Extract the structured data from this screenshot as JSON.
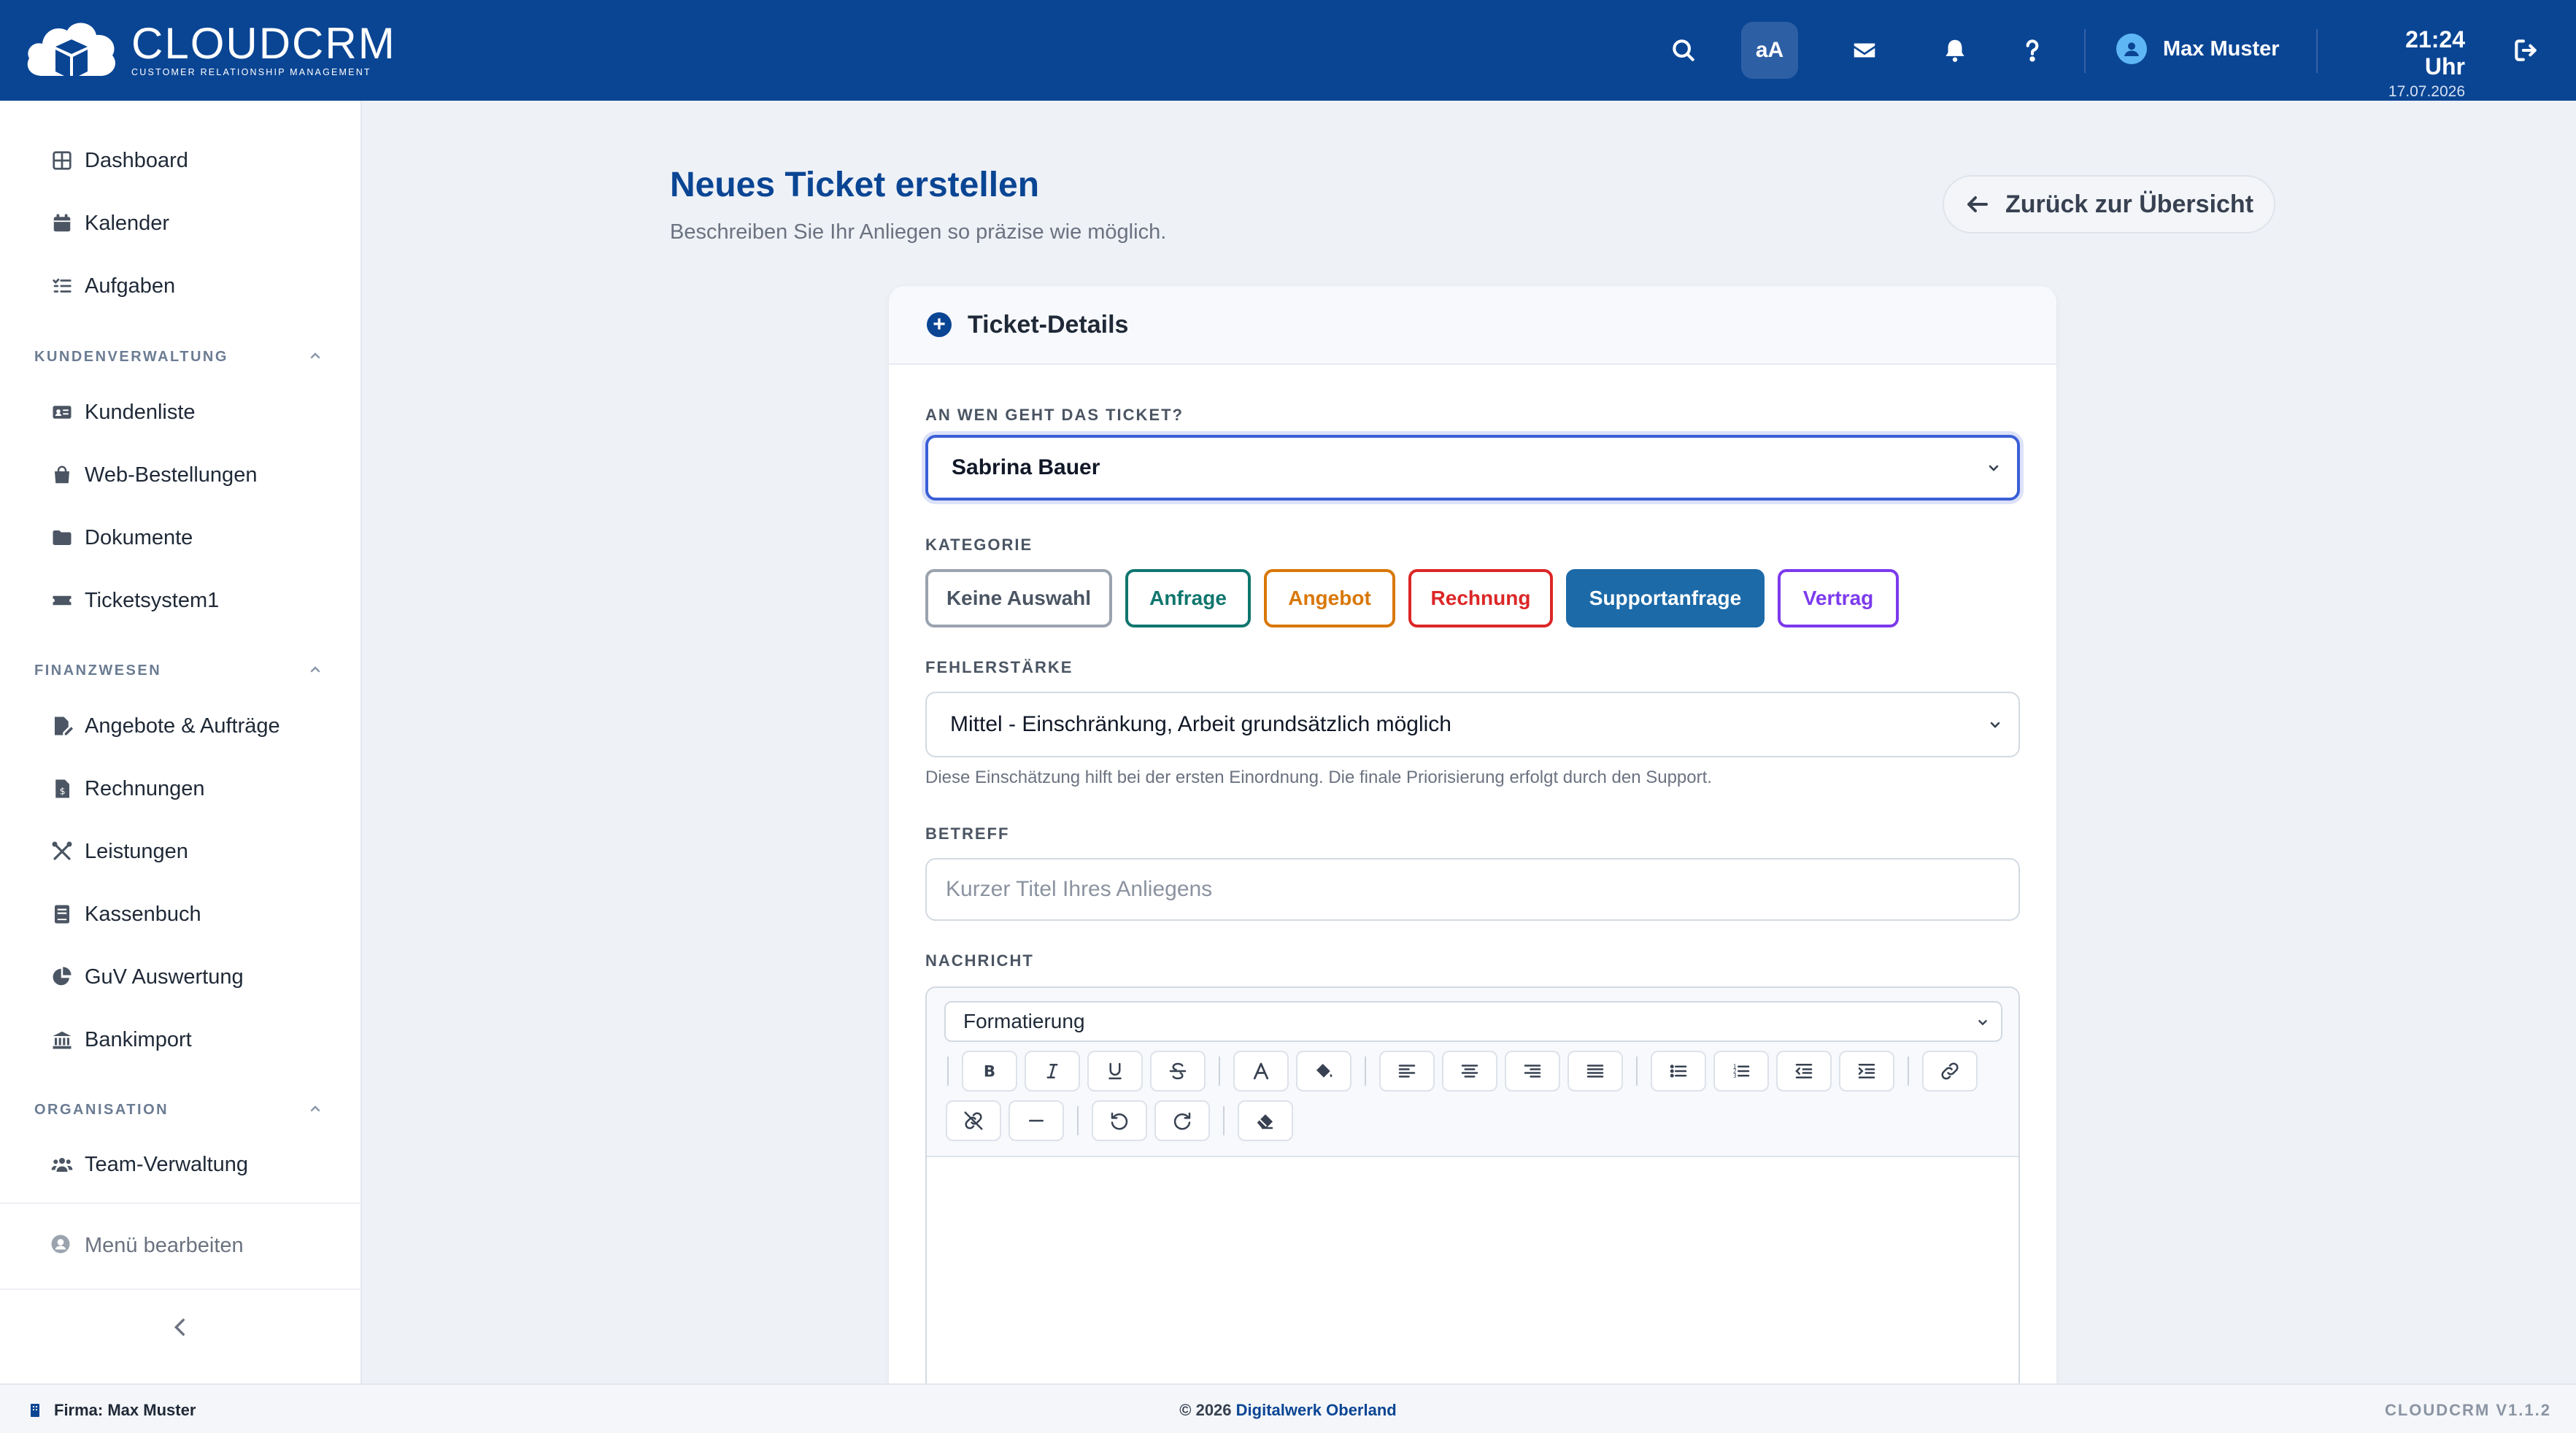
{
  "app": {
    "logo_title": "CLOUDCRM",
    "logo_subtitle": "CUSTOMER RELATIONSHIP MANAGEMENT"
  },
  "header": {
    "font_size_label": "aA",
    "user_name": "Max Muster",
    "time": "21:24 Uhr",
    "date": "17.07.2026",
    "icons": [
      "search-icon",
      "font-size-icon",
      "mail-icon",
      "bell-icon",
      "help-icon",
      "user-icon",
      "logout-icon"
    ]
  },
  "sidebar": {
    "top_items": [
      {
        "label": "Dashboard",
        "icon": "dashboard-icon"
      },
      {
        "label": "Kalender",
        "icon": "calendar-icon"
      },
      {
        "label": "Aufgaben",
        "icon": "tasks-icon"
      }
    ],
    "sections": [
      {
        "title": "KUNDENVERWALTUNG",
        "items": [
          {
            "label": "Kundenliste",
            "icon": "id-card-icon"
          },
          {
            "label": "Web-Bestellungen",
            "icon": "shopping-bag-icon"
          },
          {
            "label": "Dokumente",
            "icon": "folder-icon"
          },
          {
            "label": "Ticketsystem1",
            "icon": "ticket-icon"
          }
        ]
      },
      {
        "title": "FINANZWESEN",
        "items": [
          {
            "label": "Angebote & Aufträge",
            "icon": "file-signature-icon"
          },
          {
            "label": "Rechnungen",
            "icon": "invoice-icon"
          },
          {
            "label": "Leistungen",
            "icon": "tools-icon"
          },
          {
            "label": "Kassenbuch",
            "icon": "book-icon"
          },
          {
            "label": "GuV Auswertung",
            "icon": "pie-chart-icon"
          },
          {
            "label": "Bankimport",
            "icon": "bank-icon"
          }
        ]
      },
      {
        "title": "ORGANISATION",
        "items": [
          {
            "label": "Team-Verwaltung",
            "icon": "users-icon"
          }
        ]
      }
    ],
    "edit_menu": "Menü bearbeiten"
  },
  "page": {
    "title": "Neues Ticket erstellen",
    "subtitle": "Beschreiben Sie Ihr Anliegen so präzise wie möglich.",
    "back_button": "Zurück zur Übersicht"
  },
  "form": {
    "card_title": "Ticket-Details",
    "recipient_label": "AN WEN GEHT DAS TICKET?",
    "recipient_value": "Sabrina Bauer",
    "category_label": "KATEGORIE",
    "categories": [
      {
        "label": "Keine Auswahl",
        "color": "#9aa3ae",
        "text_color": "#4b5563",
        "selected": false
      },
      {
        "label": "Anfrage",
        "color": "#0f766e",
        "text_color": "#0f766e",
        "selected": false
      },
      {
        "label": "Angebot",
        "color": "#d97706",
        "text_color": "#d97706",
        "selected": false
      },
      {
        "label": "Rechnung",
        "color": "#dc2626",
        "text_color": "#dc2626",
        "selected": false
      },
      {
        "label": "Supportanfrage",
        "color": "#1c6aa8",
        "text_color": "#ffffff",
        "selected": true
      },
      {
        "label": "Vertrag",
        "color": "#7c3aed",
        "text_color": "#7c3aed",
        "selected": false
      }
    ],
    "severity_label": "FEHLERSTÄRKE",
    "severity_value": "Mittel - Einschränkung, Arbeit grundsätzlich möglich",
    "severity_hint": "Diese Einschätzung hilft bei der ersten Einordnung. Die finale Priorisierung erfolgt durch den Support.",
    "subject_label": "BETREFF",
    "subject_placeholder": "Kurzer Titel Ihres Anliegens",
    "message_label": "NACHRICHT",
    "format_select": "Formatierung",
    "toolbar_icons": [
      "bold-icon",
      "italic-icon",
      "underline-icon",
      "strikethrough-icon",
      "font-color-icon",
      "fill-color-icon",
      "align-left-icon",
      "align-center-icon",
      "align-right-icon",
      "align-justify-icon",
      "bullet-list-icon",
      "numbered-list-icon",
      "outdent-icon",
      "indent-icon",
      "link-icon",
      "unlink-icon",
      "horizontal-rule-icon",
      "undo-icon",
      "redo-icon",
      "eraser-icon"
    ]
  },
  "footer": {
    "company": "Firma: Max Muster",
    "copyright": "© 2026",
    "vendor": "Digitalwerk Oberland",
    "version": "CLOUDCRM V1.1.2"
  },
  "colors": {
    "brand": "#0a4594",
    "focus": "#3b5fd6"
  }
}
